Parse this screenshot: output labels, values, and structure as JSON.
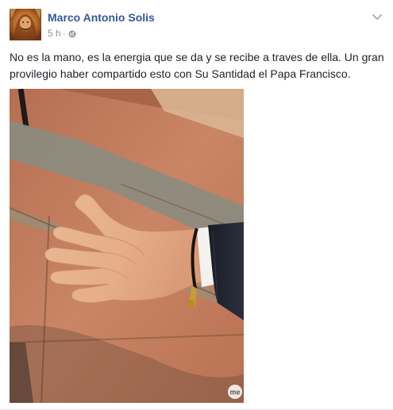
{
  "post": {
    "author": "Marco Antonio Solis",
    "timestamp": "5 h",
    "separator": "·",
    "privacy_icon": "globe-icon",
    "menu_icon": "chevron-down-icon",
    "text": "No es la mano, es la energia que se da y se recibe a traves de ella. Un gran provilegio haber compartido esto con Su Santidad el Papa Francisco.",
    "photo_watermark": "me"
  },
  "colors": {
    "author_link": "#365899",
    "meta_text": "#90949c",
    "body_text": "#1d2129"
  }
}
